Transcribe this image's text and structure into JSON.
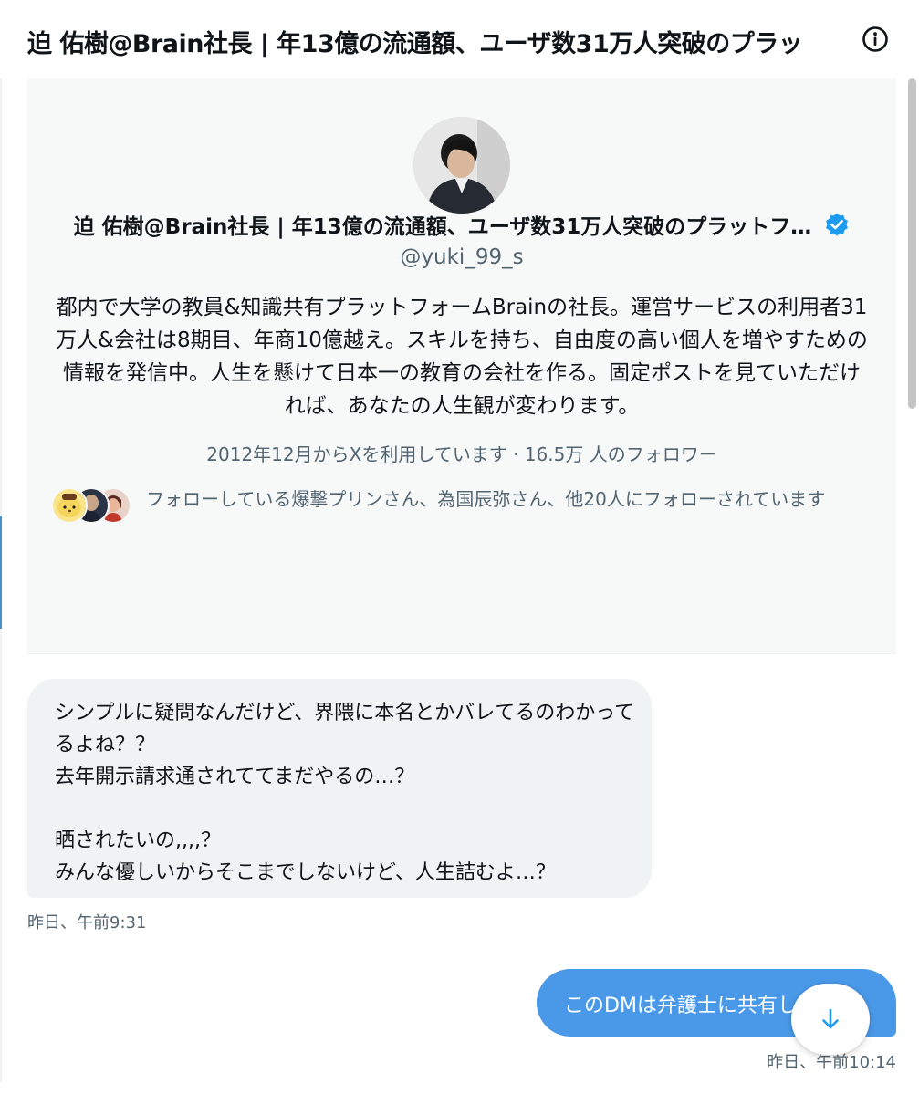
{
  "header": {
    "title": "迫 佑樹@Brain社長 | 年13億の流通額、ユーザ数31万人突破のプラッ",
    "info_icon": "info-icon"
  },
  "profile": {
    "name": "迫 佑樹@Brain社長 | 年13億の流通額、ユーザ数31万人突破のプラットフ…",
    "verified": true,
    "handle": "@yuki_99_s",
    "bio": "都内で大学の教員&知識共有プラットフォームBrainの社長。運営サービスの利用者31万人&会社は8期目、年商10億越え。スキルを持ち、自由度の高い個人を増やすための情報を発信中。人生を懸けて日本一の教育の会社を作る。固定ポストを見ていただければ、あなたの人生観が変わります。",
    "meta": "2012年12月からXを利用しています · 16.5万 人のフォロワー",
    "followed_by": "フォローしている爆撃プリンさん、為国辰弥さん、他20人にフォローされています",
    "accent_color": "#1d9bf0"
  },
  "messages": [
    {
      "direction": "received",
      "text": "シンプルに疑問なんだけど、界隈に本名とかバレてるのわかってるよね？？\n去年開示請求通されててまだやるの…？\n\n晒されたいの,,,,？\nみんな優しいからそこまでしないけど、人生詰むよ…？",
      "time": "昨日、午前9:31"
    },
    {
      "direction": "sent",
      "text": "このDMは弁護士に共有します",
      "time": "昨日、午前10:14",
      "bubble_color": "#4a99e9"
    }
  ],
  "scroll_down_icon": "arrow-down-icon"
}
